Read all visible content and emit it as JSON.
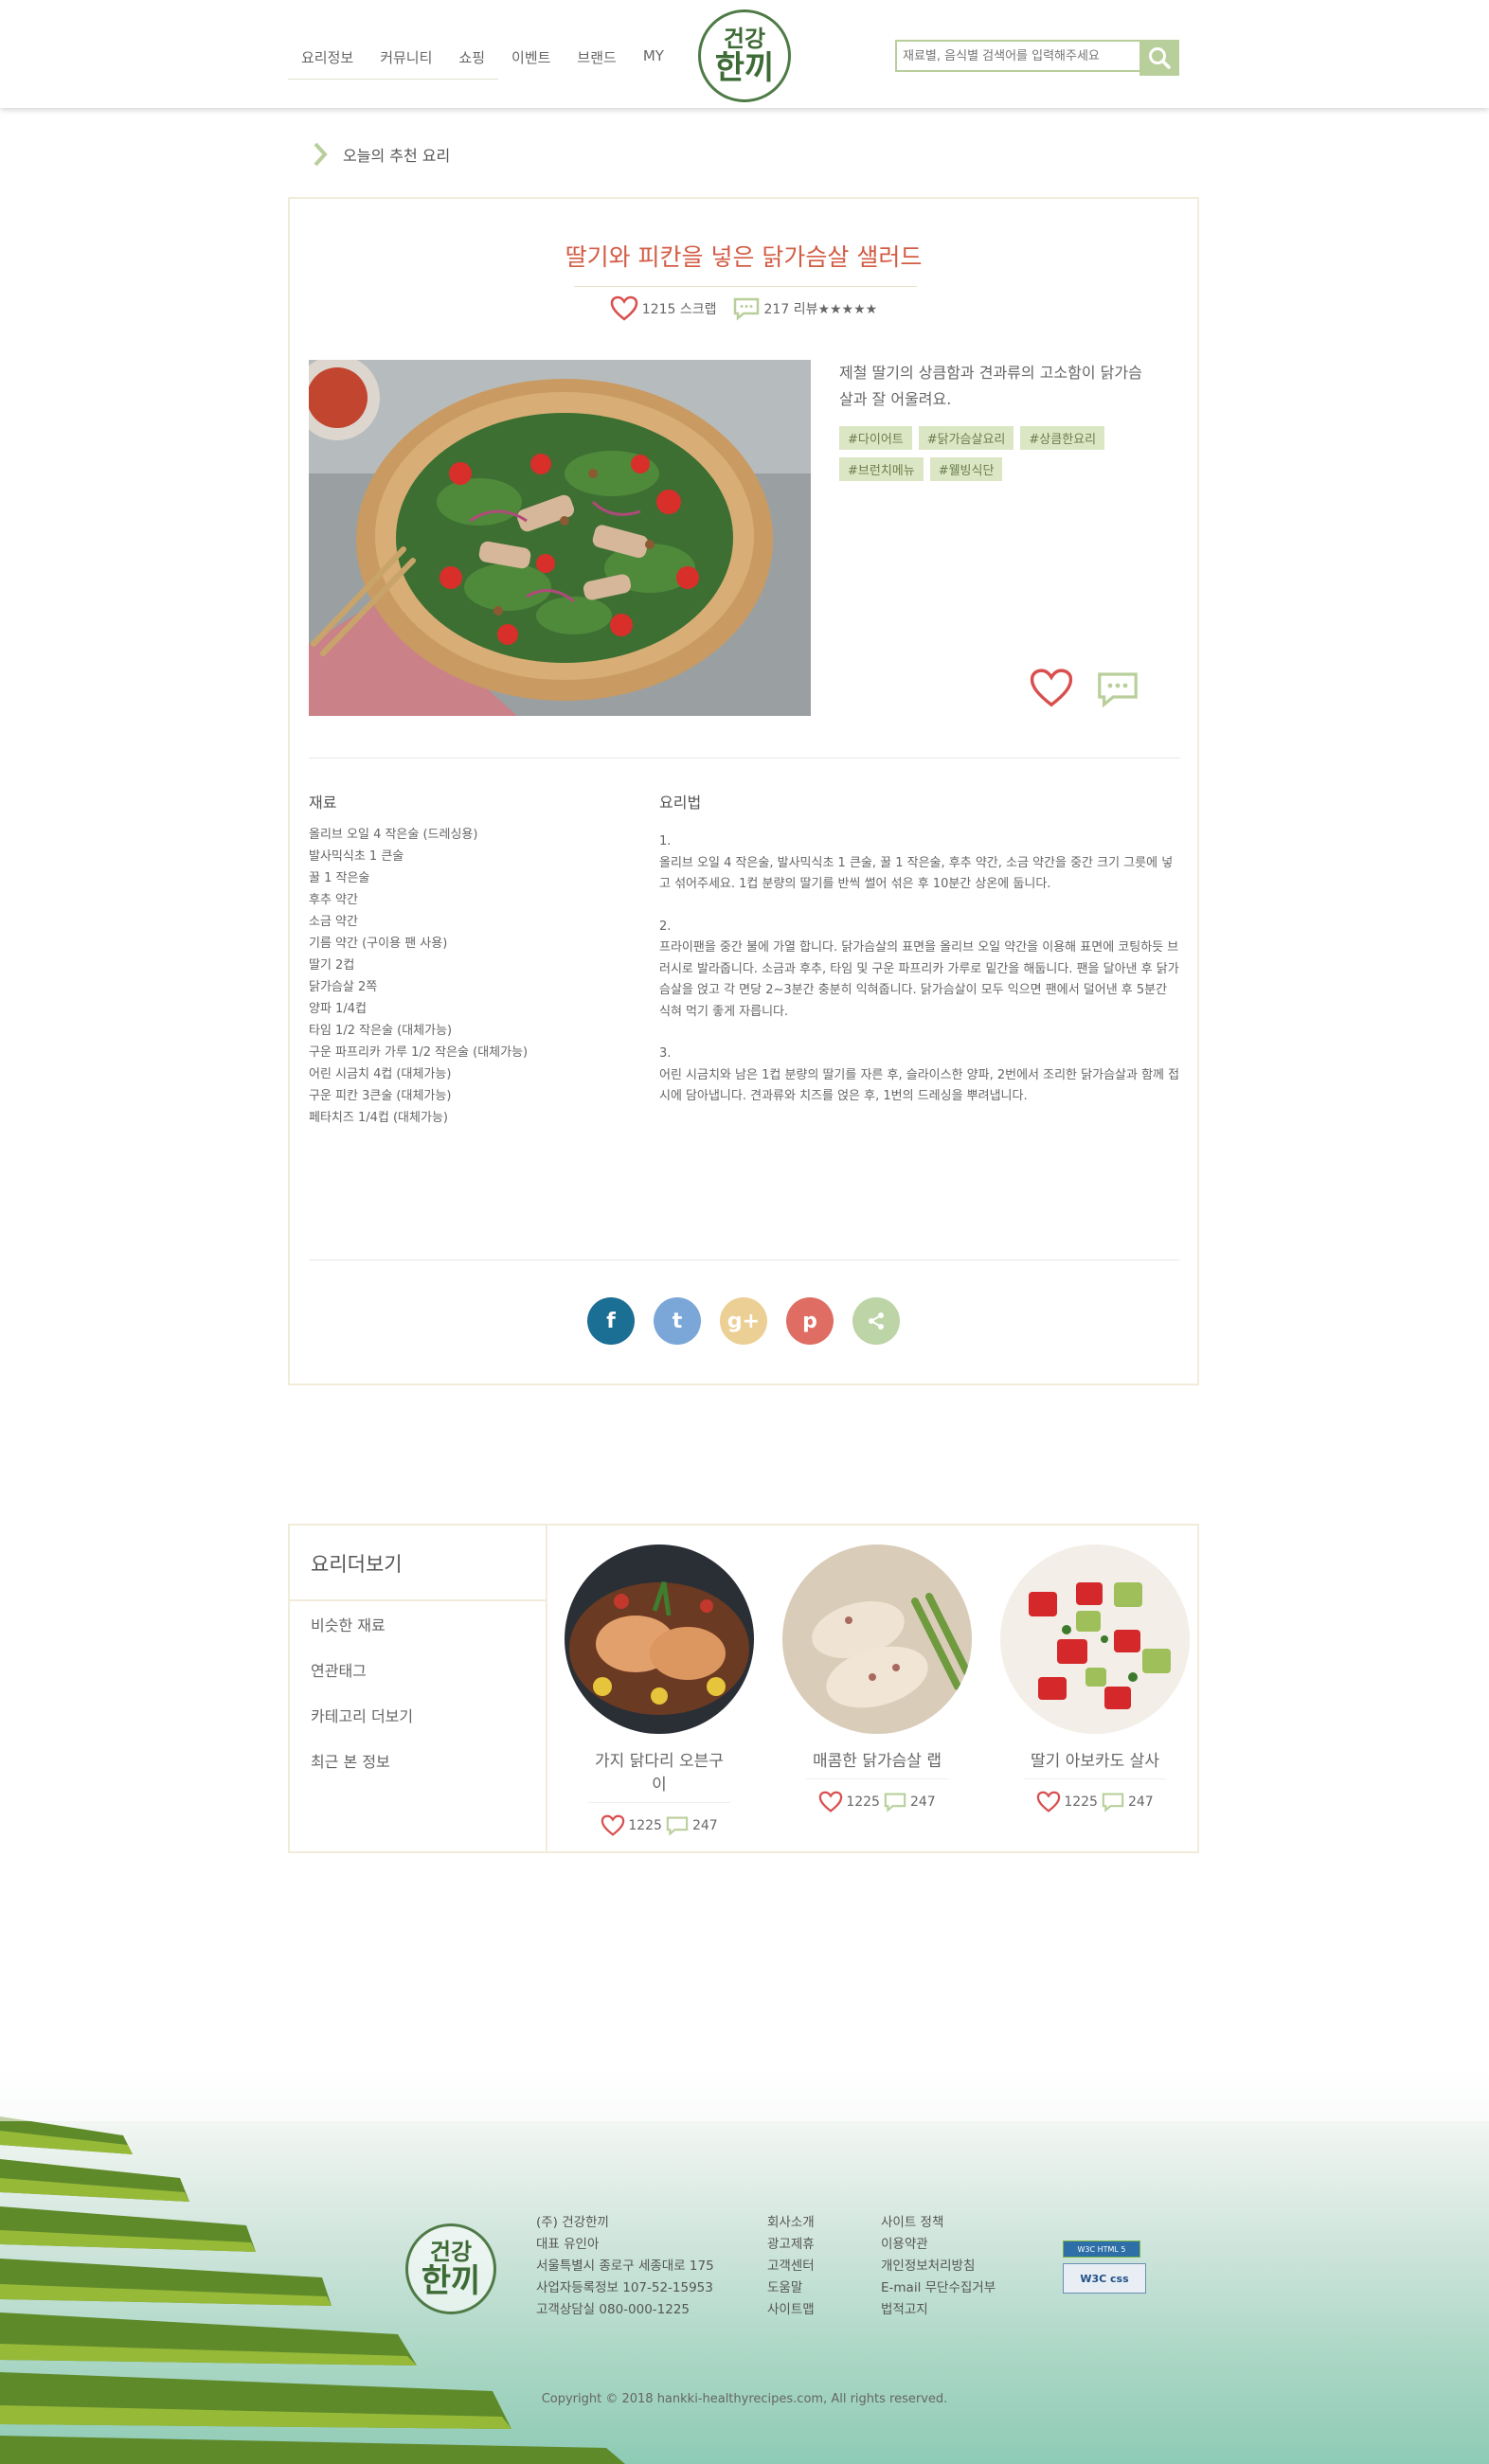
{
  "header": {
    "nav": [
      "요리정보",
      "커뮤니티",
      "쇼핑",
      "이벤트",
      "브랜드",
      "MY"
    ],
    "logo": {
      "line1": "건강",
      "line2": "한끼"
    },
    "search_placeholder": "재료별, 음식별 검색어를 입력해주세요"
  },
  "breadcrumb": {
    "label": "오늘의 추천 요리"
  },
  "recipe": {
    "title": "딸기와 피칸을 넣은 닭가슴살 샐러드",
    "scrap_count": "1215 스크랩",
    "review_count": "217 리뷰★★★★★",
    "description": "제철 딸기의 상큼함과 견과류의 고소함이 닭가슴살과 잘 어울려요.",
    "tags": [
      "#다이어트",
      "#닭가슴살요리",
      "#상큼한요리",
      "#브런치메뉴",
      "#웰빙식단"
    ],
    "ingredients_heading": "재료",
    "ingredients": [
      "올리브 오일 4 작은술 (드레싱용)",
      "발사믹식초 1 큰술",
      "꿀 1 작은술",
      "후추 약간",
      "소금 약간",
      "기름 약간 (구이용 팬 사용)",
      "딸기 2컵",
      "닭가슴살 2쪽",
      "양파 1/4컵",
      "타임 1/2 작은술 (대체가능)",
      "구운 파프리카 가루 1/2 작은술 (대체가능)",
      "어린 시금치 4컵 (대체가능)",
      "구운 피칸 3큰술 (대체가능)",
      "페타치즈 1/4컵 (대체가능)"
    ],
    "method_heading": "요리법",
    "steps": [
      {
        "num": "1.",
        "text": "올리브 오일 4 작은술, 발사믹식초 1 큰술, 꿀 1 작은술, 후추 약간, 소금 약간을 중간 크기 그릇에 넣고 섞어주세요. 1컵 분량의 딸기를 반씩 썰어 섞은 후 10분간 상온에 둡니다."
      },
      {
        "num": "2.",
        "text": "프라이팬을 중간 불에 가열 합니다. 닭가슴살의 표면을 올리브 오일 약간을 이용해 표면에 코팅하듯 브러시로 발라줍니다. 소금과 후추, 타임 및 구운 파프리카 가루로 밑간을 해둡니다. 팬을 달아낸 후 닭가슴살을 얹고 각 면당 2~3분간 충분히 익혀줍니다. 닭가슴살이 모두 익으면 팬에서 덜어낸 후 5분간 식혀 먹기 좋게 자릅니다."
      },
      {
        "num": "3.",
        "text": "어린 시금치와 남은 1컵 분량의 딸기를 자른 후, 슬라이스한 양파, 2번에서 조리한 닭가슴살과 함께 접시에 담아냅니다. 견과류와 치즈를 얹은 후, 1번의 드레싱을 뿌려냅니다."
      }
    ],
    "share": [
      {
        "name": "facebook",
        "glyph": "f",
        "color": "#1b6e94"
      },
      {
        "name": "twitter",
        "glyph": "t",
        "color": "#7aa7d7"
      },
      {
        "name": "google-plus",
        "glyph": "g+",
        "color": "#eccf94"
      },
      {
        "name": "pinterest",
        "glyph": "p",
        "color": "#df6d63"
      },
      {
        "name": "share",
        "glyph": "<",
        "color": "#bcd4a6"
      }
    ]
  },
  "more": {
    "title": "요리더보기",
    "nav": [
      "비슷한 재료",
      "연관태그",
      "카테고리 더보기",
      "최근 본 정보"
    ],
    "cards": [
      {
        "name": "가지 닭다리 오븐구이",
        "likes": "1225",
        "comments": "247"
      },
      {
        "name": "매콤한 닭가슴살 랩",
        "likes": "1225",
        "comments": "247"
      },
      {
        "name": "딸기 아보카도 살사",
        "likes": "1225",
        "comments": "247"
      }
    ]
  },
  "footer": {
    "logo": {
      "line1": "건강",
      "line2": "한끼"
    },
    "company": [
      "(주) 건강한끼",
      "대표 유인아",
      "서울특별시 종로구 세종대로 175",
      "사업자등록정보 107-52-15953",
      "고객상담실 080-000-1225"
    ],
    "links1": [
      "회사소개",
      "광고제휴",
      "고객센터",
      "도움말",
      "사이트맵"
    ],
    "links2": [
      "사이트 정책",
      "이용약관",
      "개인정보처리방침",
      "E-mail 무단수집거부",
      "법적고지"
    ],
    "badge_html": "W3C HTML 5",
    "badge_css": "W3C css",
    "copyright": "Copyright © 2018 hankki-healthyrecipes.com, All rights reserved."
  }
}
